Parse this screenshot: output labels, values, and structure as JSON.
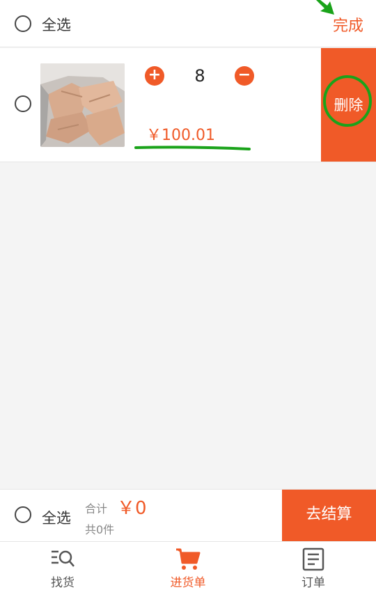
{
  "header": {
    "select_all": "全选",
    "done": "完成"
  },
  "cart": {
    "items": [
      {
        "quantity": "8",
        "price": "￥100.01",
        "delete_label": "删除"
      }
    ]
  },
  "footer": {
    "select_all": "全选",
    "total_label": "合计",
    "total_value": "￥0",
    "count": "共0件",
    "checkout_label": "去结算"
  },
  "tabs": [
    {
      "label": "找货",
      "icon": "search-list-icon"
    },
    {
      "label": "进货单",
      "icon": "cart-icon",
      "active": true
    },
    {
      "label": "订单",
      "icon": "order-icon"
    }
  ],
  "colors": {
    "accent": "#f05a28",
    "annotation": "#1aa31a"
  }
}
